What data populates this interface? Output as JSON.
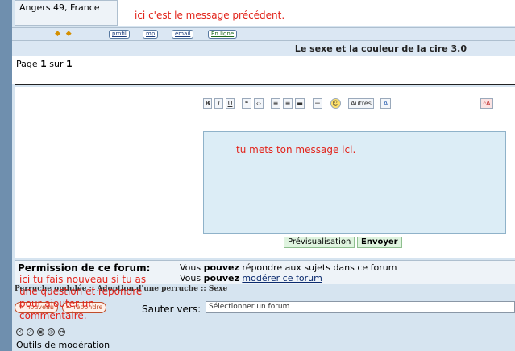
{
  "post": {
    "location": "Angers 49, France",
    "note_previous": "ici c'est le message précédent."
  },
  "buttons": {
    "stars": "◆ ◆",
    "profil": "profil",
    "mp": "mp",
    "email": "email",
    "online": "En ligne"
  },
  "topic": {
    "title": "Le sexe et la couleur de la cire 3.0"
  },
  "pagination": {
    "prefix": "Page ",
    "current": "1",
    "middle": " sur ",
    "total": "1"
  },
  "editor": {
    "bold": "B",
    "italic": "I",
    "underline": "U",
    "more": "Autres",
    "note_message": "tu mets ton message ici.",
    "preview": "Prévisualisation",
    "send": "Envoyer"
  },
  "permissions": {
    "label": "Permission de ce forum:",
    "line1_a": "Vous ",
    "line1_b": "pouvez",
    "line1_c": " répondre aux sujets dans ce forum",
    "line2_a": "Vous ",
    "line2_b": "pouvez",
    "line2_c": "modérer ce forum"
  },
  "breadcrumb": "Perruche ondulée :: Adoption d'une perruche :: Sexe",
  "annotation_new": "ici tu fais nouveau si tu as une question et répondre pour ajouter un commentaire.",
  "jump": {
    "label": "Sauter vers:",
    "placeholder": "Sélectionner un forum"
  },
  "mod_tools": {
    "label": "Outils de modération"
  },
  "colors": {
    "annotation": "#e2231a",
    "stripe": "#6f8fae",
    "title_bg": "#dbe7f3"
  }
}
